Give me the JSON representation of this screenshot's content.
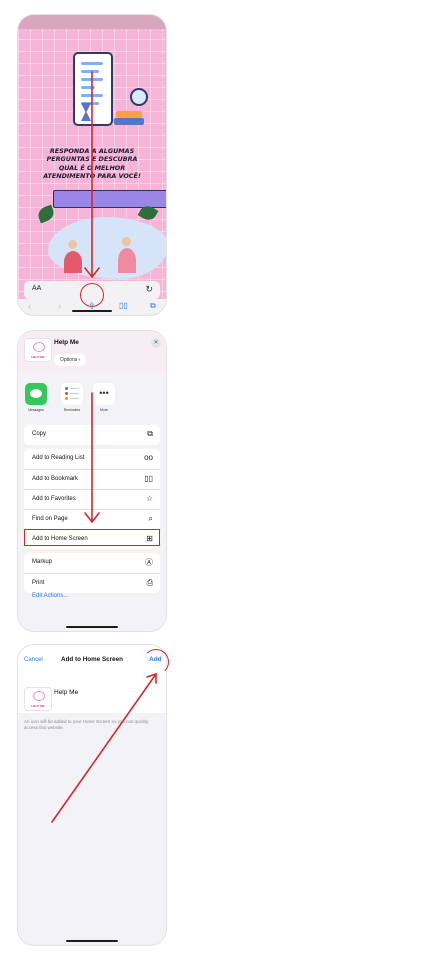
{
  "panel1": {
    "headline": "RESPONDA A ALGUMAS PERGUNTAS E DESCUBRA QUAL É O MELHOR ATENDIMENTO PARA VOCÊ!",
    "address_aa": "AA"
  },
  "panel2": {
    "site_name": "Help Me",
    "options_label": "Options",
    "apps": [
      "Messages",
      "Reminders",
      "More"
    ],
    "actions_group1": [
      "Copy"
    ],
    "actions_group2": [
      "Add to Reading List",
      "Add to Bookmark",
      "Add to Favorites",
      "Find on Page",
      "Add to Home Screen"
    ],
    "actions_group3": [
      "Markup",
      "Print"
    ],
    "edit_actions": "Edit Actions..."
  },
  "panel3": {
    "cancel": "Cancel",
    "title": "Add to Home Screen",
    "add": "Add",
    "site_name": "Help Me",
    "note": "An icon will be added to your Home Screen so you can quickly access this website."
  },
  "colors": {
    "accent_blue": "#2b7de9",
    "annotation_red": "#d6262a",
    "site_pink": "#f6b4d8"
  },
  "icons": {
    "panel1": [
      "refresh-icon",
      "back-icon",
      "forward-icon",
      "share-icon",
      "bookmarks-icon",
      "tabs-icon"
    ],
    "panel2": [
      "close-icon",
      "copy-icon",
      "reading-list-icon",
      "bookmark-icon",
      "favorites-icon",
      "find-icon",
      "add-square-icon",
      "markup-icon",
      "print-icon"
    ]
  }
}
